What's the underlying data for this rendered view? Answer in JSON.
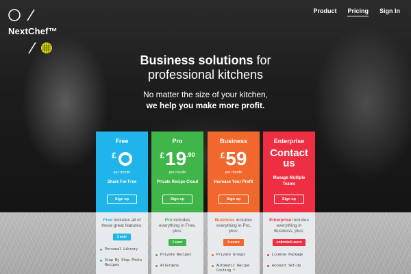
{
  "brand": {
    "name": "NextChef™"
  },
  "nav": {
    "items": [
      "Product",
      "Pricing",
      "Sign In"
    ]
  },
  "hero": {
    "headline_bold": "Business solutions",
    "headline_rest": " for",
    "headline_line2": "professional kitchens",
    "sub_line1": "No matter the size of your kitchen,",
    "sub_line2": "we help you make more profit."
  },
  "plans": [
    {
      "name": "Free",
      "currency": "£",
      "amount": "",
      "decimals": "",
      "period": "per month",
      "tagline": "Share For Free",
      "button": "Sign up",
      "lead_bold": "Free",
      "lead_rest": " includes all of these great features:",
      "users": "1 user",
      "features": [
        "Personal Library",
        "Step By Step Photo Recipes"
      ],
      "color": "#20b5ea"
    },
    {
      "name": "Pro",
      "currency": "£",
      "amount": "19",
      "decimals": ".90",
      "period": "per month",
      "tagline": "Private Recipe Cloud",
      "button": "Sign up",
      "lead_bold": "Pro",
      "lead_rest": " includes everything in Free, plus:",
      "users": "1 user",
      "features": [
        "Private Recipes",
        "Allergens"
      ],
      "color": "#3fb54a"
    },
    {
      "name": "Business",
      "currency": "£",
      "amount": "59",
      "decimals": "",
      "period": "per month",
      "tagline": "Increase Your Profit",
      "button": "Sign up",
      "lead_bold": "Business",
      "lead_rest": " includes everything in Pro, plus:",
      "users": "5 users",
      "features": [
        "Private Groups",
        "Automatic Recipe Costing *"
      ],
      "color": "#f2682c"
    },
    {
      "name": "Enterprise",
      "currency": "",
      "amount": "Contact us",
      "decimals": "",
      "period": "",
      "tagline": "Manage Multiple Teams",
      "button": "Sign up",
      "lead_bold": "Enterprise",
      "lead_rest": " includes everything in Business, plus:",
      "users": "unlimited users",
      "features": [
        "License Package",
        "Account Set-Up"
      ],
      "color": "#ee2f43"
    }
  ]
}
